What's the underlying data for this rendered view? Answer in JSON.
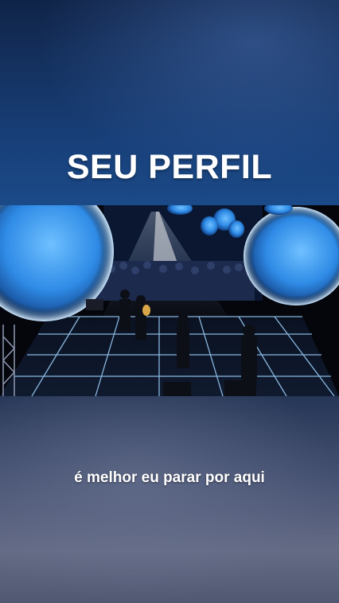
{
  "overlay": {
    "title": "SEU PERFIL",
    "caption": "é melhor eu parar por aqui"
  },
  "colors": {
    "title_text": "#ffffff",
    "caption_text": "#ffffff",
    "balloon_blue": "#2f8be6",
    "stage_grid": "#9fd4ff"
  }
}
